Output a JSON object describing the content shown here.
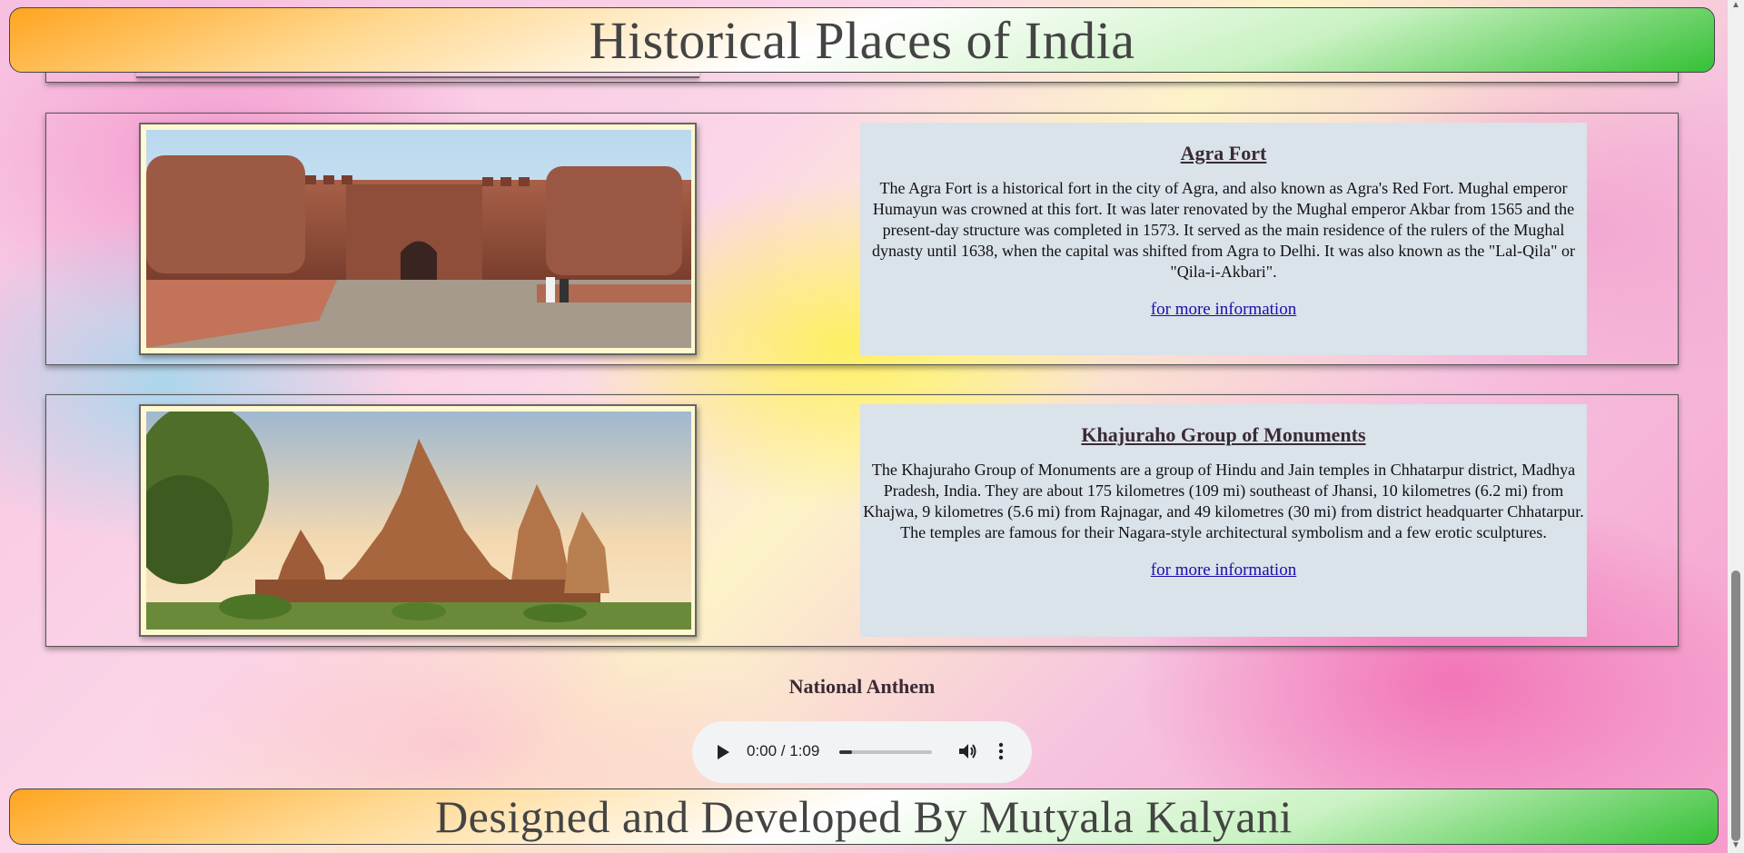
{
  "header": {
    "title": "Historical Places of India"
  },
  "places": [
    {
      "name": "Agra Fort",
      "image_alt": "agra-fort-photo",
      "description": "The Agra Fort is a historical fort in the city of Agra, and also known as Agra's Red Fort. Mughal emperor Humayun was crowned at this fort. It was later renovated by the Mughal emperor Akbar from 1565 and the present-day structure was completed in 1573. It served as the main residence of the rulers of the Mughal dynasty until 1638, when the capital was shifted from Agra to Delhi. It was also known as the \"Lal-Qila\" or \"Qila-i-Akbari\".",
      "link": "for more information"
    },
    {
      "name": "Khajuraho Group of Monuments",
      "image_alt": "khajuraho-temples-photo",
      "description": "The Khajuraho Group of Monuments are a group of Hindu and Jain temples in Chhatarpur district, Madhya Pradesh, India. They are about 175 kilometres (109 mi) southeast of Jhansi, 10 kilometres (6.2 mi) from Khajwa, 9 kilometres (5.6 mi) from Rajnagar, and 49 kilometres (30 mi) from district headquarter Chhatarpur. The temples are famous for their Nagara-style architectural symbolism and a few erotic sculptures.",
      "link": "for more information"
    }
  ],
  "anthem": {
    "title": "National Anthem",
    "time": "0:00 / 1:09",
    "progress": 0.14
  },
  "footer": {
    "text": "Designed and Developed By Mutyala Kalyani"
  },
  "colors": {
    "saffron": "#ffa520",
    "green": "#36c036",
    "info_bg": "#dae2ea",
    "link": "#1a0dab"
  },
  "icons": [
    "play-icon",
    "volume-icon",
    "more-options-icon"
  ]
}
